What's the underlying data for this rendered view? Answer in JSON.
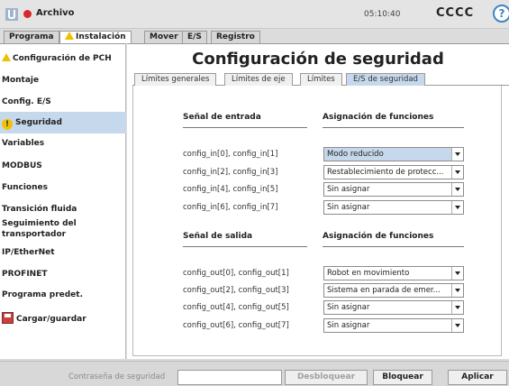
{
  "header": {
    "file_label": "Archivo",
    "clock": "05:10:40",
    "robot_name": "CCCC",
    "help_symbol": "?",
    "record_color": "#d8262b"
  },
  "main_tabs": [
    {
      "label": "Programa"
    },
    {
      "label": "Instalación"
    },
    {
      "label": "Mover"
    },
    {
      "label": "E/S"
    },
    {
      "label": "Registro"
    }
  ],
  "sidebar": {
    "items": [
      {
        "label": "Configuración de PCH"
      },
      {
        "label": "Montaje"
      },
      {
        "label": "Config. E/S"
      },
      {
        "label": "Seguridad"
      },
      {
        "label": "Variables"
      },
      {
        "label": "MODBUS"
      },
      {
        "label": "Funciones"
      },
      {
        "label": "Transición fluida"
      },
      {
        "label": "Seguimiento del"
      },
      {
        "label": "transportador"
      },
      {
        "label": "IP/EtherNet"
      },
      {
        "label": "PROFINET"
      },
      {
        "label": "Programa predet."
      },
      {
        "label": "Cargar/guardar"
      }
    ]
  },
  "content": {
    "title": "Configuración de seguridad",
    "sub_tabs": [
      {
        "label": "Límites generales"
      },
      {
        "label": "Límites de eje"
      },
      {
        "label": "Límites"
      },
      {
        "label": "E/S de seguridad"
      }
    ],
    "inputs": {
      "signal_header": "Señal de entrada",
      "assign_header": "Asignación de funciones",
      "rows": [
        {
          "signal": "config_in[0], config_in[1]",
          "value": "Modo reducido"
        },
        {
          "signal": "config_in[2], config_in[3]",
          "value": "Restablecimiento de protecc..."
        },
        {
          "signal": "config_in[4], config_in[5]",
          "value": "Sin asignar"
        },
        {
          "signal": "config_in[6], config_in[7]",
          "value": "Sin asignar"
        }
      ]
    },
    "outputs": {
      "signal_header": "Señal de salida",
      "assign_header": "Asignación de funciones",
      "rows": [
        {
          "signal": "config_out[0], config_out[1]",
          "value": "Robot en movimiento"
        },
        {
          "signal": "config_out[2], config_out[3]",
          "value": "Sistema en parada de emer..."
        },
        {
          "signal": "config_out[4], config_out[5]",
          "value": "Sin asignar"
        },
        {
          "signal": "config_out[6], config_out[7]",
          "value": "Sin asignar"
        }
      ]
    }
  },
  "footer": {
    "password_label": "Contraseña de seguridad",
    "password_value": "",
    "unlock_label": "Desbloquear",
    "lock_label": "Bloquear",
    "apply_label": "Aplicar"
  }
}
